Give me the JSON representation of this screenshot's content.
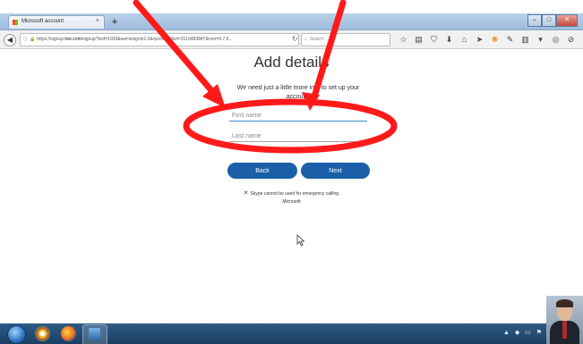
{
  "browser": {
    "tab_title": "Microsoft account",
    "tab_close": "×",
    "new_tab": "+",
    "url_prefix": "https://signup.",
    "url_host": "live.com",
    "url_rest": "/signup?lcid=1033&wa=wsignin1.0&rpsnv=13&ct=1510483847&rver=6.7.6...",
    "search_placeholder": "Search",
    "window_controls": {
      "minimize": "–",
      "maximize": "□",
      "close": "✕"
    }
  },
  "form": {
    "heading": "Add details",
    "subtext": "We need just a little more info to set up your account.",
    "first_name_placeholder": "First name",
    "last_name_placeholder": "Last name",
    "back_label": "Back",
    "next_label": "Next",
    "skype_note": "Skype cannot be used for emergency calling.",
    "footer": "Microsoft"
  },
  "annotation": {
    "color": "#ff1a1a",
    "shapes": [
      "arrow",
      "arrow",
      "ellipse"
    ]
  },
  "taskbar": {
    "tray_icons": "▲ ◆ ▭ ⚑"
  },
  "colors": {
    "primary_button": "#1a5fa8",
    "input_focus_border": "#3b8fd0",
    "annotation_red": "#ff1a1a"
  }
}
